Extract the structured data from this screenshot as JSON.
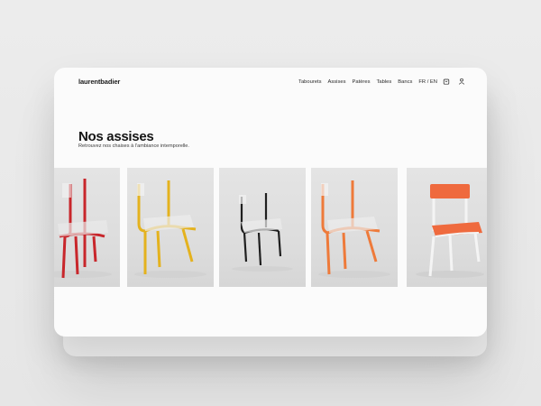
{
  "brand": {
    "logo": "laurentbadier"
  },
  "nav": {
    "items": [
      "Tabourets",
      "Assises",
      "Patères",
      "Tables",
      "Bancs"
    ],
    "language": "FR / EN"
  },
  "icons": {
    "cart": "cart-icon",
    "account": "user-icon"
  },
  "page": {
    "title": "Nos assises",
    "subtitle": "Retrouvez nos chaises à l'ambiance intemporelle."
  },
  "products": [
    {
      "name": "chair-red",
      "frame_color": "#c8262b"
    },
    {
      "name": "chair-yellow",
      "frame_color": "#e4b21e"
    },
    {
      "name": "chair-black",
      "frame_color": "#1f1f1f"
    },
    {
      "name": "chair-orange",
      "frame_color": "#ee7a3a"
    },
    {
      "name": "chair-white-orange",
      "frame_color": "#f4f4f4",
      "seat_color": "#ef6a3e"
    }
  ]
}
